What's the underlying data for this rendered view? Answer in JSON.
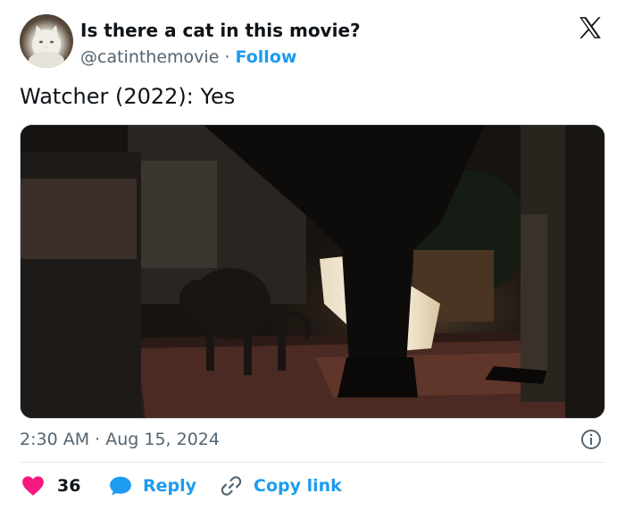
{
  "header": {
    "display_name": "Is there a cat in this movie?",
    "handle": "@catinthemovie",
    "separator": "·",
    "follow_label": "Follow"
  },
  "tweet": {
    "text": "Watcher (2022): Yes",
    "timestamp": "2:30 AM · Aug 15, 2024"
  },
  "actions": {
    "like_count": "36",
    "reply_label": "Reply",
    "copy_link_label": "Copy link"
  },
  "colors": {
    "brand_blue": "#1d9bf0",
    "like_red": "#f91880",
    "text_primary": "#0f1419",
    "text_secondary": "#536471"
  },
  "icons": {
    "brand": "x-logo-icon",
    "info": "info-icon",
    "like": "heart-icon",
    "reply": "speech-bubble-icon",
    "copy": "link-icon"
  }
}
